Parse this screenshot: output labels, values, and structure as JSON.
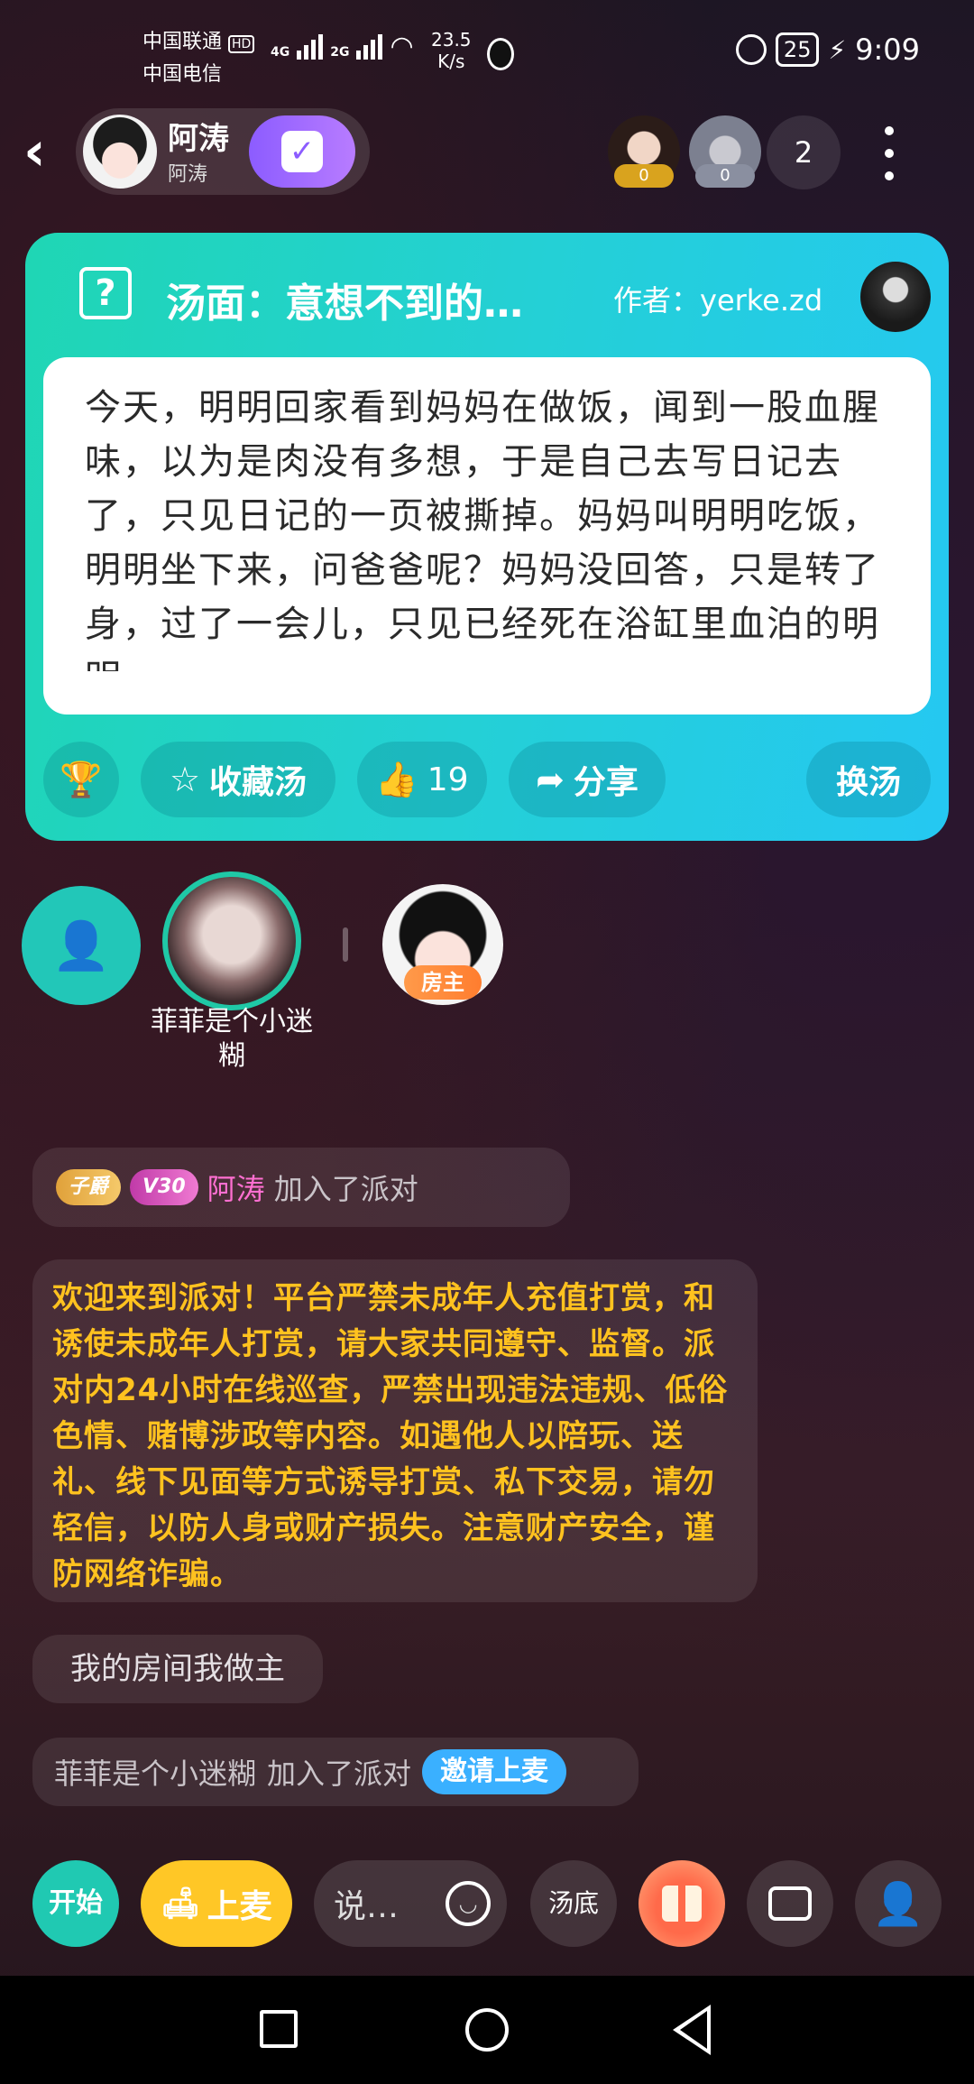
{
  "status_bar": {
    "carrier1": "中国联通",
    "hd": "HD",
    "carrier2": "中国电信",
    "net1": "4G",
    "net2": "2G",
    "speed_value": "23.5",
    "speed_unit": "K/s",
    "battery": "25",
    "time": "9:09"
  },
  "header": {
    "owner_name": "阿涛",
    "owner_sub": "阿涛",
    "viewers": [
      {
        "badge": "0"
      },
      {
        "badge": "0"
      }
    ],
    "viewer_count": "2"
  },
  "card": {
    "title": "汤面：意想不到的…",
    "author": "作者：yerke.zd",
    "story": "今天，明明回家看到妈妈在做饭，闻到一股血腥味，以为是肉没有多想，于是自己去写日记去了，只见日记的一页被撕掉。妈妈叫明明吃饭，明明坐下来，问爸爸呢？妈妈没回答，只是转了身，过了一会儿，只见已经死在浴缸里血泊的明明",
    "collect_label": "收藏汤",
    "like_count": "19",
    "share_label": "分享",
    "switch_label": "换汤"
  },
  "seats": {
    "seat1_name": "菲菲是个小迷糊",
    "host_label": "房主"
  },
  "chat": {
    "join1": {
      "badge1": "子爵",
      "badge2": "V30",
      "name": "阿涛",
      "text": "加入了派对"
    },
    "notice": "欢迎来到派对！平台严禁未成年人充值打赏，和诱使未成年人打赏，请大家共同遵守、监督。派对内24小时在线巡查，严禁出现违法违规、低俗色情、赌博涉政等内容。如遇他人以陪玩、送礼、线下见面等方式诱导打赏、私下交易，请勿轻信，以防人身或财产损失。注意财产安全，谨防网络诈骗。",
    "room_msg": "我的房间我做主",
    "join2": {
      "name": "菲菲是个小迷糊",
      "text": "加入了派对",
      "invite": "邀请上麦"
    }
  },
  "toolbar": {
    "start": "开始",
    "mic": "上麦",
    "say_placeholder": "说…",
    "soup_bottom": "汤底"
  },
  "colors": {
    "accent_teal": "#1fd6b4",
    "accent_cyan": "#25c8f2",
    "notice_text": "#ffc21f",
    "mic_yellow": "#ffc726",
    "invite_blue": "#3ab0ff"
  }
}
